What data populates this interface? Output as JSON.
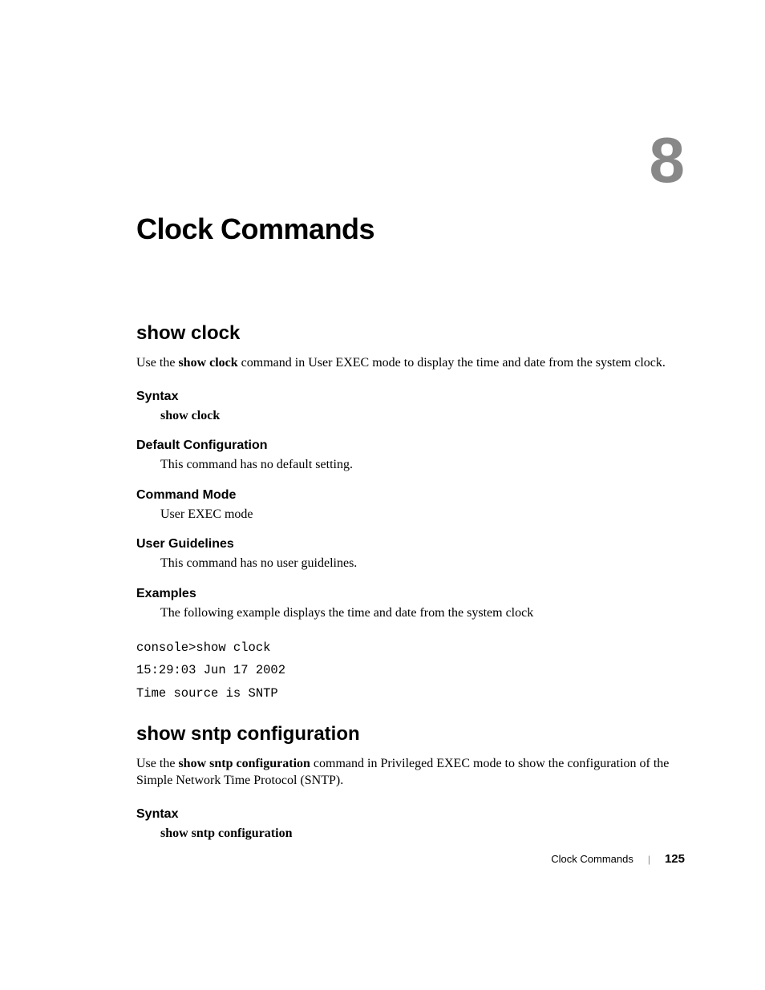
{
  "chapter": {
    "number": "8",
    "title": "Clock Commands"
  },
  "sections": [
    {
      "title": "show clock",
      "intro_pre": "Use the ",
      "intro_bold": "show clock",
      "intro_post": "  command in User EXEC mode to display the time and date from the system clock.",
      "syntax_heading": "Syntax",
      "syntax_body": "show clock",
      "default_heading": "Default Configuration",
      "default_body": "This command has no default setting.",
      "mode_heading": "Command Mode",
      "mode_body": "User EXEC mode",
      "guidelines_heading": "User Guidelines",
      "guidelines_body": "This command has no user guidelines.",
      "examples_heading": "Examples",
      "examples_body": "The following example displays the time and date from the system clock",
      "example_code": "console>show clock\n15:29:03 Jun 17 2002\nTime source is SNTP"
    },
    {
      "title": "show sntp configuration",
      "intro_pre": "Use the ",
      "intro_bold": "show sntp configuration",
      "intro_post": " command in Privileged EXEC mode to show the configuration of the Simple Network Time Protocol (SNTP).",
      "syntax_heading": "Syntax",
      "syntax_body": "show sntp configuration"
    }
  ],
  "footer": {
    "label": "Clock Commands",
    "page": "125"
  }
}
